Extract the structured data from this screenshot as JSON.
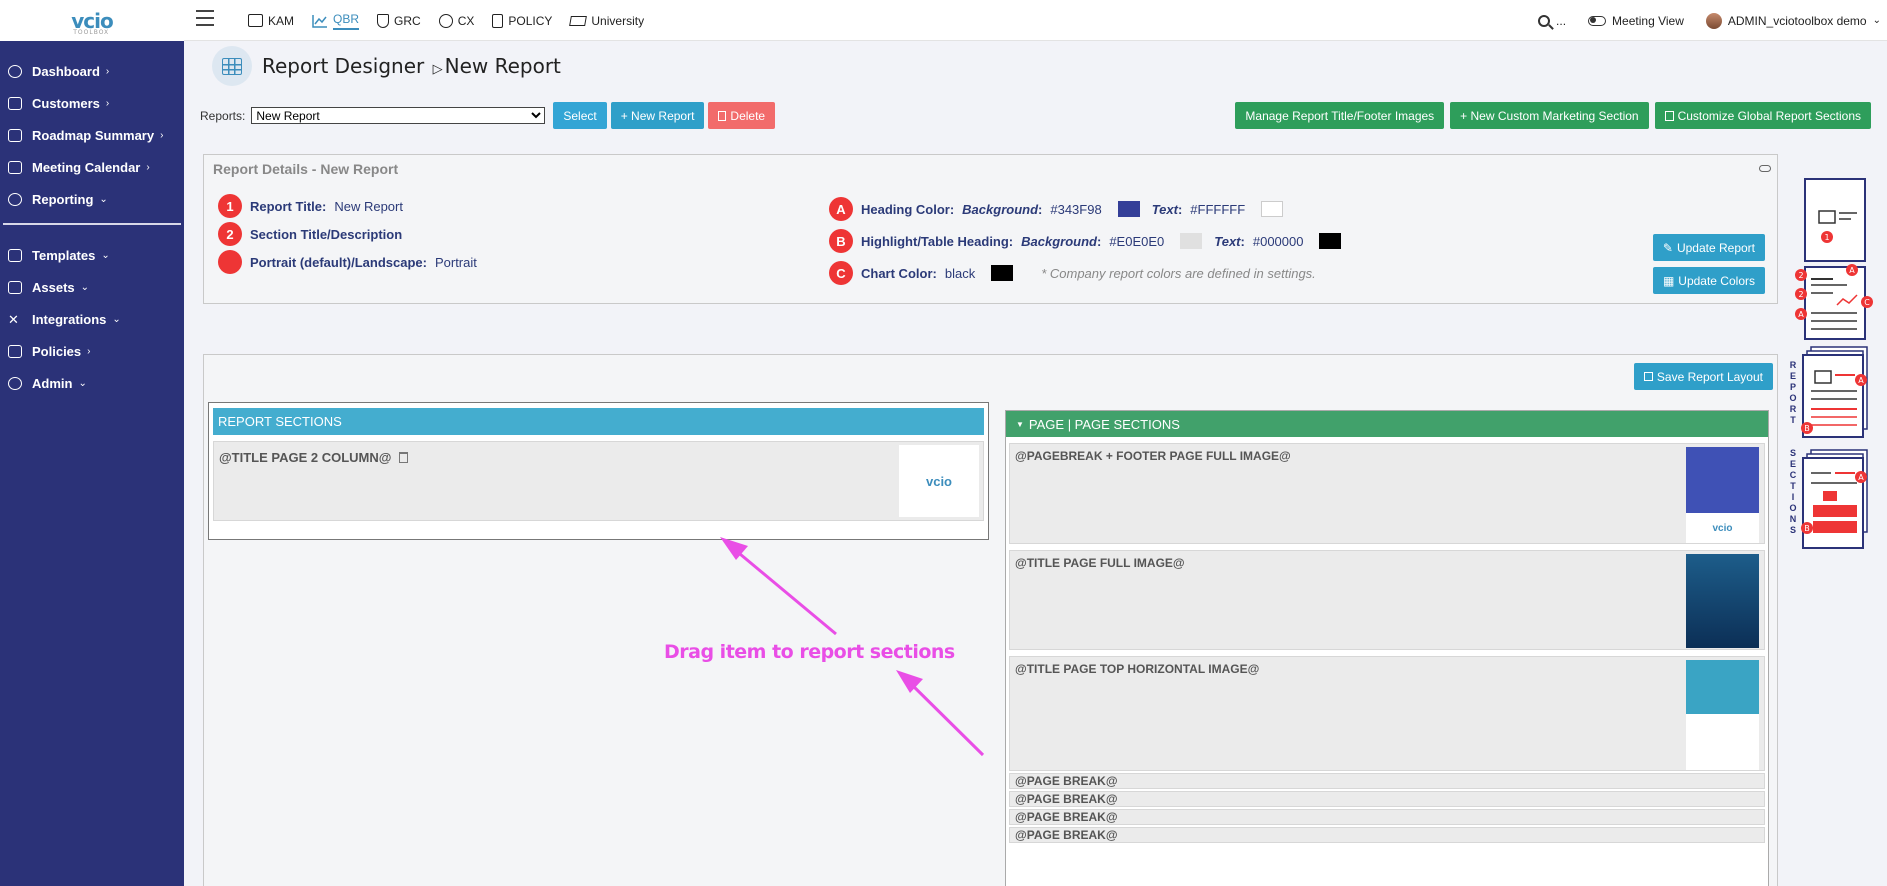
{
  "topbar": {
    "logo": "vcio",
    "logo_sub": "TOOLBOX",
    "nav": [
      {
        "label": "KAM",
        "icon": "contact-card-icon"
      },
      {
        "label": "QBR",
        "icon": "line-chart-icon"
      },
      {
        "label": "GRC",
        "icon": "shield-icon"
      },
      {
        "label": "CX",
        "icon": "smiley-icon"
      },
      {
        "label": "POLICY",
        "icon": "document-icon"
      },
      {
        "label": "University",
        "icon": "graduation-cap-icon"
      }
    ],
    "search_label": "...",
    "meeting_view": "Meeting View",
    "user": "ADMIN_vciotoolbox demo"
  },
  "sidebar": {
    "items": [
      {
        "label": "Dashboard",
        "chevron": "›"
      },
      {
        "label": "Customers",
        "chevron": "›"
      },
      {
        "label": "Roadmap Summary",
        "chevron": "›"
      },
      {
        "label": "Meeting Calendar",
        "chevron": "›"
      },
      {
        "label": "Reporting",
        "chevron": "⌄"
      }
    ],
    "items2": [
      {
        "label": "Templates",
        "chevron": "⌄"
      },
      {
        "label": "Assets",
        "chevron": "⌄"
      },
      {
        "label": "Integrations",
        "chevron": "⌄"
      },
      {
        "label": "Policies",
        "chevron": "›"
      },
      {
        "label": "Admin",
        "chevron": "⌄"
      }
    ]
  },
  "page": {
    "title": "Report Designer",
    "subtitle": "New Report",
    "reports_label": "Reports:",
    "reports_selected": "New Report",
    "select_btn": "Select",
    "new_report_btn": "+ New Report",
    "delete_btn": "Delete",
    "manage_btn": "Manage Report Title/Footer Images",
    "new_custom_btn": "+ New Custom Marketing Section",
    "customize_btn": "Customize Global Report Sections"
  },
  "details": {
    "heading": "Report Details - New Report",
    "left": [
      {
        "badge": "1",
        "label": "Report Title:",
        "value": "New Report"
      },
      {
        "badge": "2",
        "label": "Section Title/Description",
        "value": ""
      },
      {
        "badge": "",
        "label": "Portrait (default)/Landscape:",
        "value": "Portrait"
      }
    ],
    "heading_color": {
      "badge": "A",
      "label": "Heading Color:",
      "bg_label": "Background",
      "bg_value": "#343F98",
      "text_label": "Text",
      "text_value": "#FFFFFF"
    },
    "highlight": {
      "badge": "B",
      "label": "Highlight/Table Heading:",
      "bg_label": "Background",
      "bg_value": "#E0E0E0",
      "text_label": "Text",
      "text_value": "#000000"
    },
    "chart": {
      "badge": "C",
      "label": "Chart Color:",
      "value": "black"
    },
    "note": "* Company report colors are defined in settings.",
    "update_report_btn": "Update Report",
    "update_colors_btn": "Update Colors"
  },
  "layout": {
    "save_btn": "Save Report Layout",
    "report_sections_header": "REPORT SECTIONS",
    "report_sections": [
      {
        "label": "@TITLE PAGE 2 COLUMN@",
        "thumb": "vcio"
      }
    ],
    "page_sections_header": "PAGE | PAGE SECTIONS",
    "page_sections": [
      {
        "label": "@PAGEBREAK + FOOTER PAGE FULL IMAGE@"
      },
      {
        "label": "@TITLE PAGE FULL IMAGE@"
      },
      {
        "label": "@TITLE PAGE TOP HORIZONTAL IMAGE@"
      }
    ],
    "page_breaks": [
      "@PAGE BREAK@",
      "@PAGE BREAK@",
      "@PAGE BREAK@",
      "@PAGE BREAK@"
    ],
    "annotation": "Drag item to report sections",
    "vertical_label": "REPORT SECTIONS"
  },
  "colors": {
    "sidebar": "#2b3278",
    "heading_bg": "#343F98",
    "highlight_bg": "#E0E0E0",
    "chart": "#000000",
    "annotation": "#e94ee6"
  }
}
